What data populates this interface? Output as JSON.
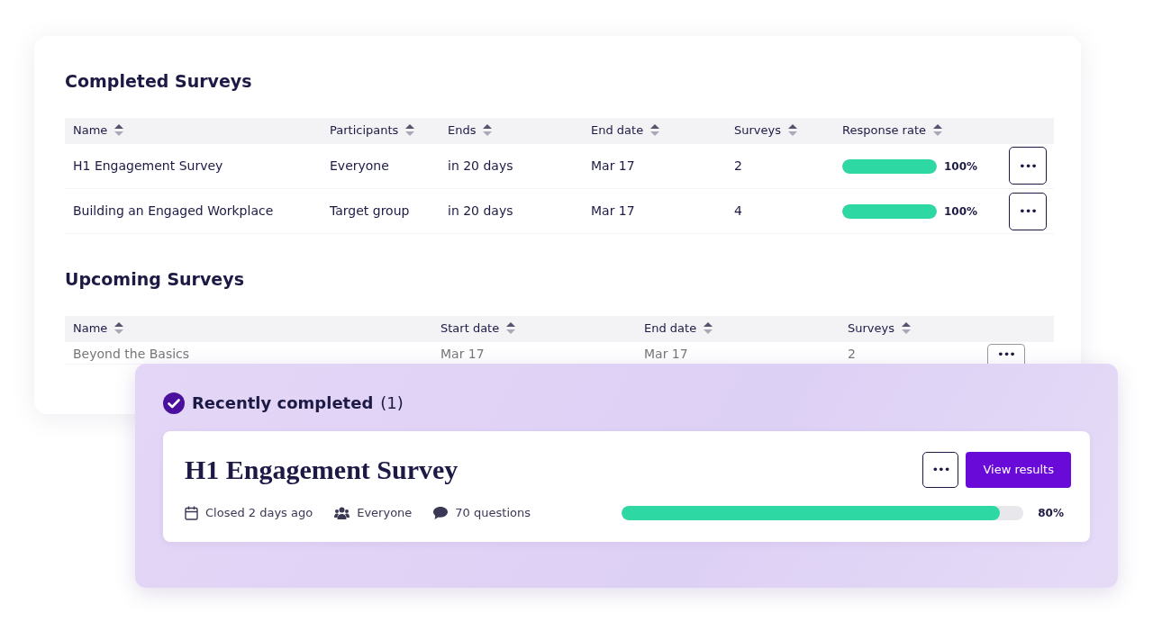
{
  "completed": {
    "title": "Completed Surveys",
    "columns": [
      "Name",
      "Participants",
      "Ends",
      "End date",
      "Surveys",
      "Response rate"
    ],
    "rows": [
      {
        "name": "H1 Engagement Survey",
        "participants": "Everyone",
        "ends": "in 20 days",
        "end_date": "Mar 17",
        "surveys": "2",
        "level": 1,
        "reading": "100%",
        "menu": "•••"
      },
      {
        "name": "Building an Engaged Workplace",
        "participants": "Target group",
        "ends": "in 20 days",
        "end_date": "Mar 17",
        "surveys": "4",
        "level": 1,
        "reading": "100%",
        "menu": "•••"
      }
    ]
  },
  "upcoming": {
    "title": "Upcoming Surveys",
    "columns": [
      "Name",
      "Start date",
      "End date",
      "Surveys"
    ],
    "rows": [
      {
        "name": "Beyond the Basics",
        "start_date": "Mar 17",
        "end_date": "Mar 17",
        "surveys": "2",
        "menu": "•••"
      }
    ]
  },
  "recent": {
    "title": "Recently completed",
    "count": "(1)",
    "survey": {
      "title": "H1 Engagement Survey",
      "menu": "•••",
      "action": "View results",
      "meta": [
        {
          "kind": "calendar",
          "text": "Closed 2 days ago"
        },
        {
          "kind": "people",
          "text": "Everyone"
        },
        {
          "kind": "comment",
          "text": "70 questions"
        }
      ],
      "level": 0.94,
      "reading": "80%"
    }
  }
}
